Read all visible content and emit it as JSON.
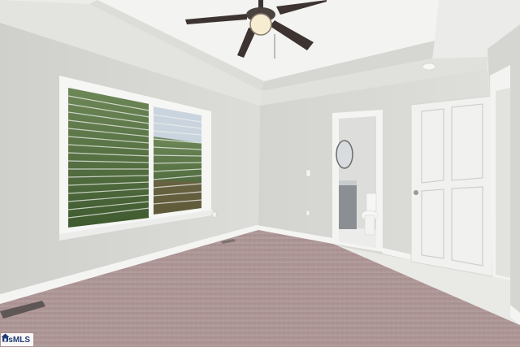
{
  "photo": {
    "subject": "empty-bedroom-interior",
    "watermark_text": "©sMLS",
    "colors": {
      "wall": "#d9dad6",
      "ceiling": "#ececea",
      "carpet": "#ad9696",
      "trim": "#f4f4f2",
      "door": "#f1f1ef",
      "window_frame": "#f6f6f4",
      "outdoor_green": "#4f6b3c",
      "sky": "#c9d4df"
    }
  }
}
